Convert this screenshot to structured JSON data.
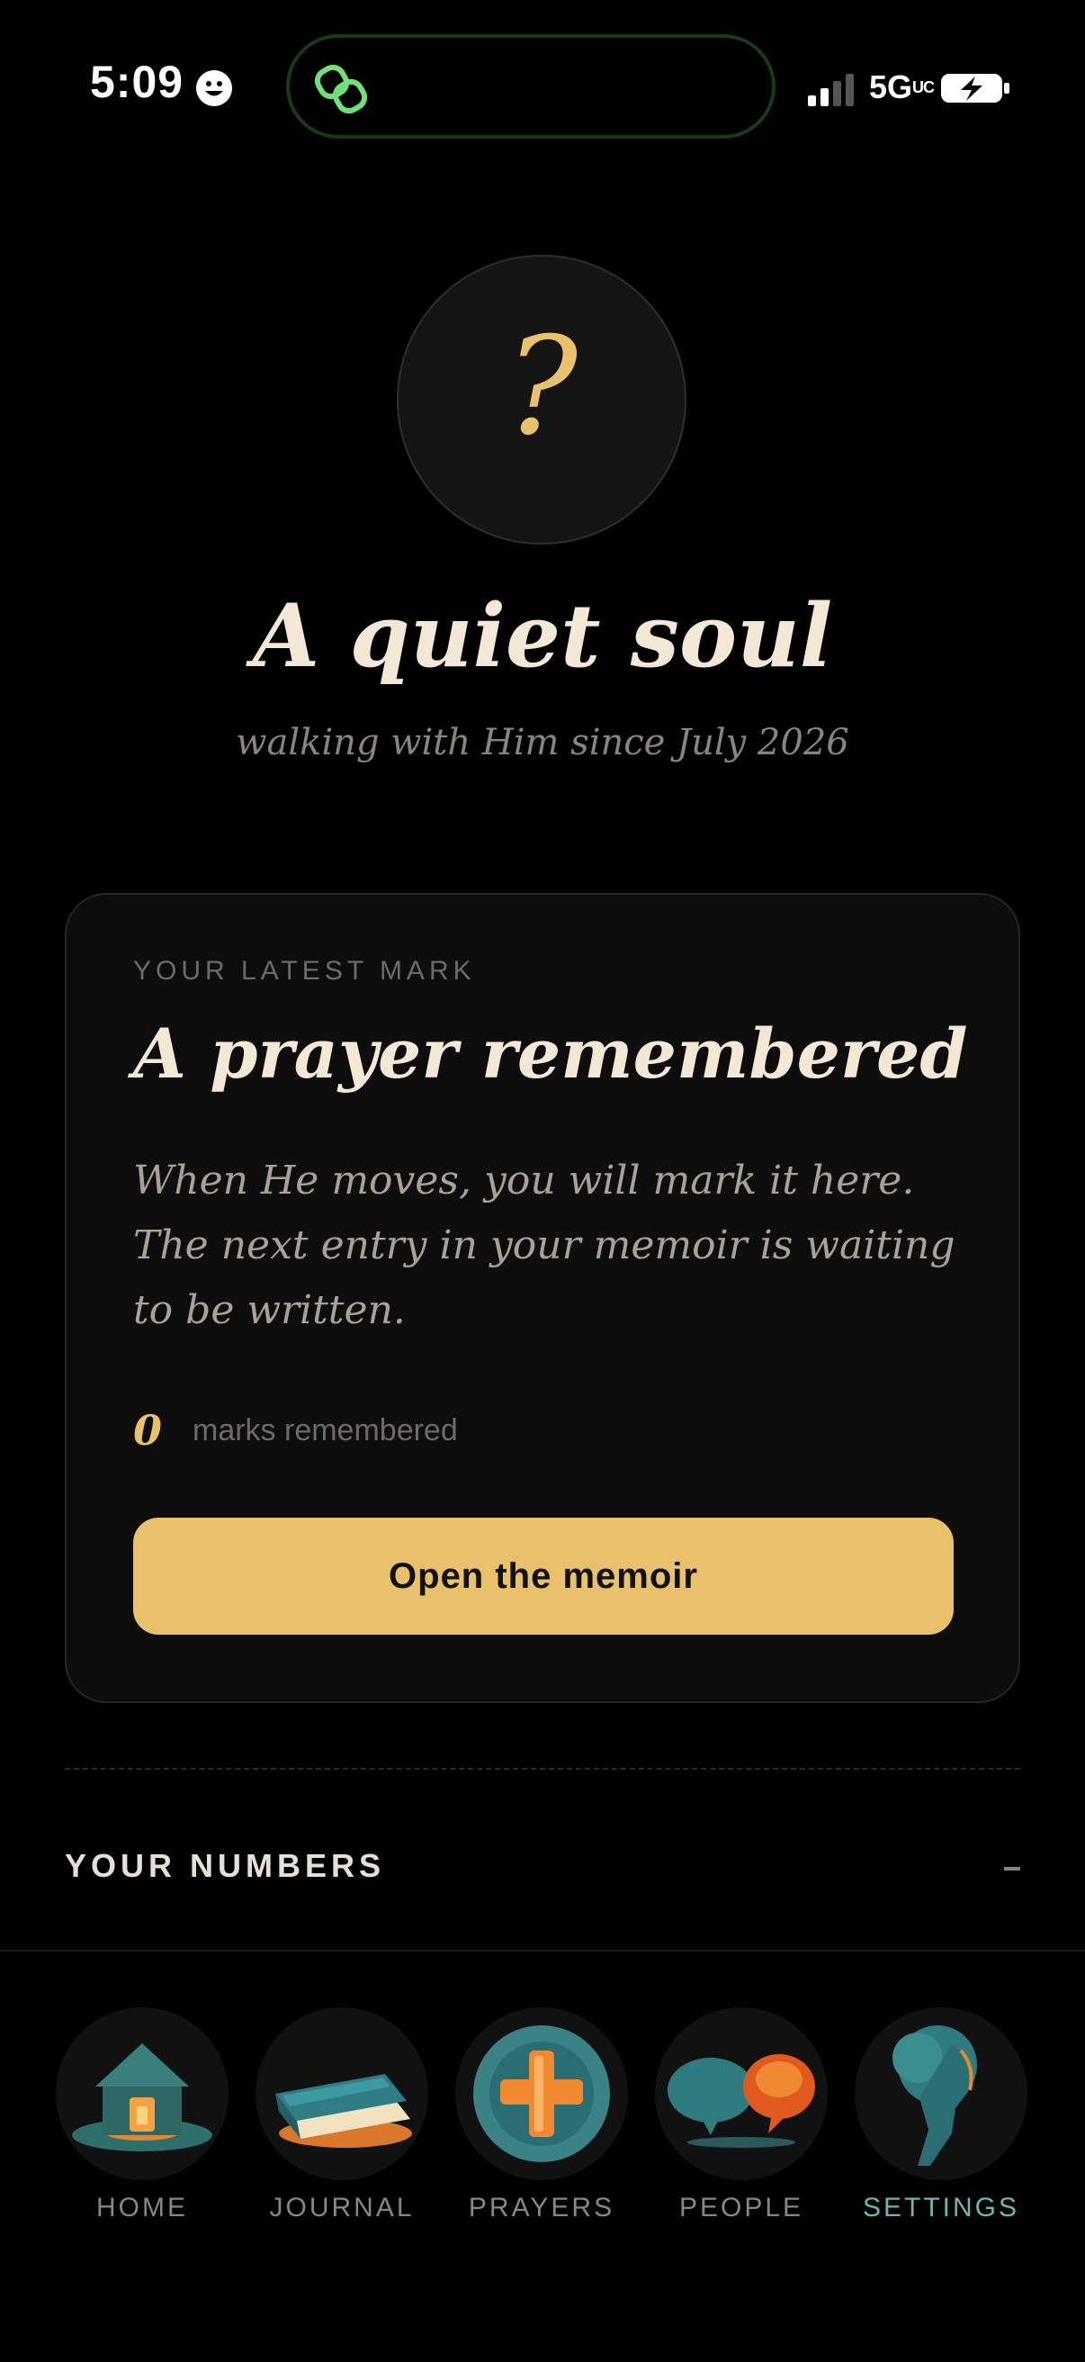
{
  "status": {
    "time": "5:09",
    "network": "5G",
    "network_sup": "UC"
  },
  "profile": {
    "avatar_symbol": "?",
    "name": "A quiet soul",
    "since": "walking with Him since July 2026"
  },
  "latest": {
    "eyebrow": "YOUR LATEST MARK",
    "heading": "A prayer remembered",
    "body": "When He moves, you will mark it here. The next entry in your memoir is waiting to be written.",
    "count": "0",
    "count_label": "marks remembered",
    "button": "Open the memoir"
  },
  "numbers": {
    "label": "YOUR NUMBERS"
  },
  "nav": [
    {
      "label": "HOME",
      "icon": "house-icon"
    },
    {
      "label": "JOURNAL",
      "icon": "book-icon"
    },
    {
      "label": "PRAYERS",
      "icon": "cross-icon"
    },
    {
      "label": "PEOPLE",
      "icon": "speech-bubbles-icon"
    },
    {
      "label": "SETTINGS",
      "icon": "head-profile-icon",
      "active": true
    }
  ],
  "colors": {
    "accent": "#e9c06c",
    "active_nav": "#6fb5b0",
    "background": "#000000",
    "card": "#0d0d0d"
  }
}
